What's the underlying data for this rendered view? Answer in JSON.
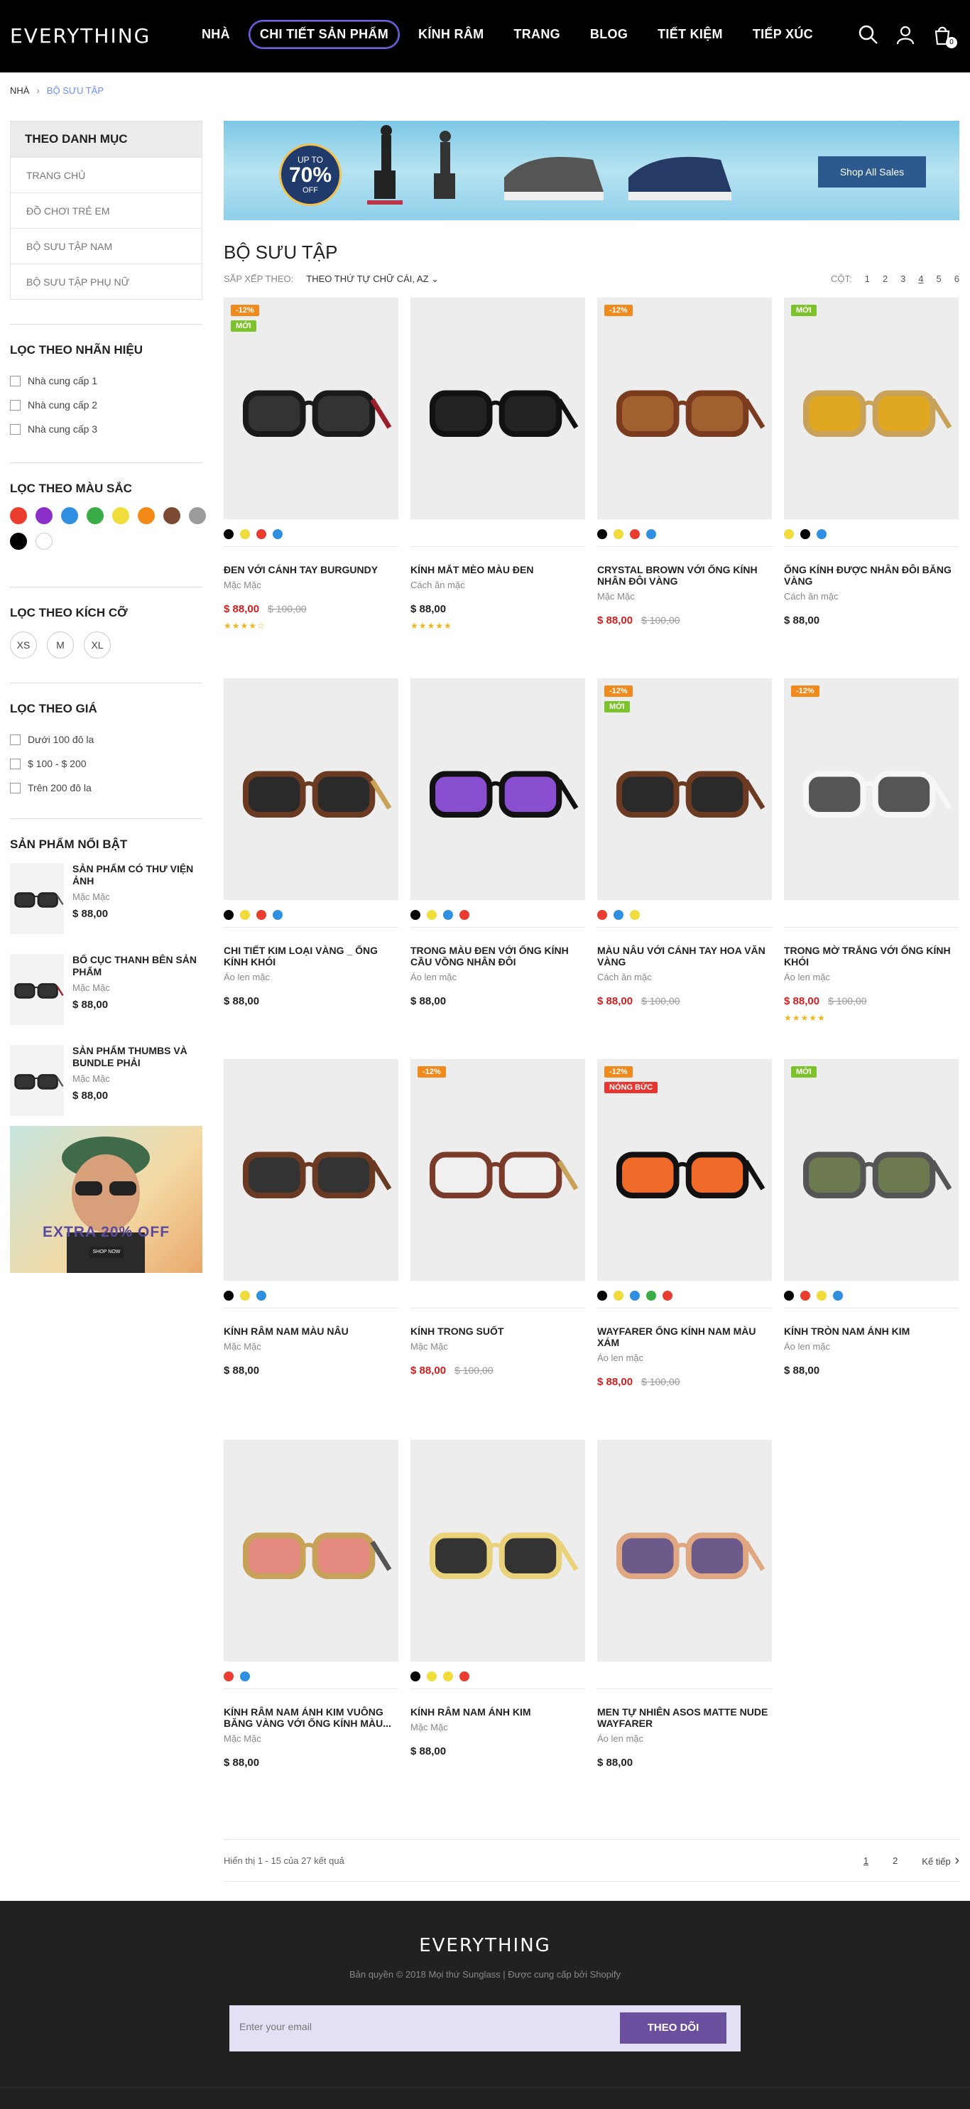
{
  "header": {
    "logo": "EVERYTHING",
    "nav": [
      "NHÀ",
      "CHI TIẾT SẢN PHẨM",
      "KÍNH RÂM",
      "TRANG",
      "BLOG",
      "TIẾT KIỆM",
      "TIẾP XÚC"
    ],
    "active_nav": "CHI TIẾT SẢN PHẨM",
    "cart_count": "0",
    "icons": [
      "search-icon",
      "user-icon",
      "cart-icon"
    ]
  },
  "breadcrumb": {
    "home": "NHÀ",
    "current": "BỘ SƯU TẬP"
  },
  "sidebar": {
    "category_title": "THEO DANH MỤC",
    "categories": [
      "TRANG CHỦ",
      "ĐỒ CHƠI TRẺ EM",
      "BỘ SƯU TẬP NAM",
      "BỘ SƯU TẬP PHỤ NỮ"
    ],
    "brand_title": "LỌC THEO NHÃN HIỆU",
    "brands": [
      "Nhà cung cấp 1",
      "Nhà cung cấp 2",
      "Nhà cung cấp 3"
    ],
    "color_title": "LỌC THEO MÀU SẮC",
    "colors": [
      "#ea3c2f",
      "#8c2fc9",
      "#2f8fe0",
      "#3aac46",
      "#f0dc3a",
      "#f38a17",
      "#7a4a32",
      "#9b9b9b",
      "#000000",
      "#ffffff"
    ],
    "size_title": "LỌC THEO KÍCH CỠ",
    "sizes": [
      "XS",
      "M",
      "XL"
    ],
    "price_title": "LỌC THEO GIÁ",
    "prices": [
      "Dưới 100 đô la",
      "$ 100 - $ 200",
      "Trên 200 đô la"
    ],
    "featured_title": "SẢN PHẨM NỔI BẬT",
    "featured": [
      {
        "name": "SẢN PHẨM CÓ THƯ VIỆN ẢNH",
        "vendor": "Mặc Mặc",
        "price": "$ 88,00"
      },
      {
        "name": "BỐ CỤC THANH BÊN SẢN PHẨM",
        "vendor": "Mặc Mặc",
        "price": "$ 88,00"
      },
      {
        "name": "SẢN PHẨM THUMBS VÀ BUNDLE PHẢI",
        "vendor": "Mặc Mặc",
        "price": "$ 88,00"
      }
    ],
    "banner_text": "EXTRA 20% OFF",
    "banner_button": "SHOP NOW"
  },
  "hero": {
    "up_to": "UP TO",
    "percent": "70%",
    "off": "OFF",
    "button": "Shop All Sales"
  },
  "collection": {
    "title": "BỘ SƯU TẬP",
    "sort_label": "SẮP XẾP THEO:",
    "sort_value": "THEO THỨ TỰ CHỮ CÁI, AZ",
    "cols_label": "CỘT:",
    "cols": [
      "1",
      "2",
      "3",
      "4",
      "5",
      "6"
    ],
    "active_col": "4"
  },
  "products": [
    {
      "name": "ĐEN VỚI CÁNH TAY BURGUNDY",
      "vendor": "Mặc Mặc",
      "price": "$ 88,00",
      "old_price": "$ 100,00",
      "badges": [
        "-12%",
        "MỚI"
      ],
      "colors": [
        "#000000",
        "#f0dc3a",
        "#ea3c2f",
        "#2f8fe0"
      ],
      "stars": "★★★★☆",
      "frame": "#1a1a1a",
      "arm": "#9b1f2a",
      "lens": "#333"
    },
    {
      "name": "KÍNH MẮT MÈO MÀU ĐEN",
      "vendor": "Cách ăn mặc",
      "price": "$ 88,00",
      "old_price": "",
      "badges": [],
      "colors": [],
      "stars": "★★★★★",
      "frame": "#111",
      "arm": "#111",
      "lens": "#222"
    },
    {
      "name": "CRYSTAL BROWN VỚI ỐNG KÍNH NHÂN ĐÔI VÀNG",
      "vendor": "Mặc Mặc",
      "price": "$ 88,00",
      "old_price": "$ 100,00",
      "badges": [
        "-12%"
      ],
      "colors": [
        "#000000",
        "#f0dc3a",
        "#ea3c2f",
        "#2f8fe0"
      ],
      "stars": "",
      "frame": "#7a3b1e",
      "arm": "#7a3b1e",
      "lens": "#a0602f"
    },
    {
      "name": "ỐNG KÍNH ĐƯỢC NHÂN ĐÔI BĂNG VÀNG",
      "vendor": "Cách ăn mặc",
      "price": "$ 88,00",
      "old_price": "",
      "badges": [
        "MỚI"
      ],
      "colors": [
        "#f0dc3a",
        "#000000",
        "#2f8fe0"
      ],
      "stars": "",
      "frame": "#c9a25a",
      "arm": "#c9a25a",
      "lens": "#e0a820"
    },
    {
      "name": "CHI TIẾT KIM LOẠI VÀNG _ ỐNG KÍNH KHÓI",
      "vendor": "Áo len mặc",
      "price": "$ 88,00",
      "old_price": "",
      "badges": [],
      "colors": [
        "#000000",
        "#f0dc3a",
        "#ea3c2f",
        "#2f8fe0"
      ],
      "stars": "",
      "frame": "#6b3a22",
      "arm": "#c9a25a",
      "lens": "#2a2a2a"
    },
    {
      "name": "TRONG MÀU ĐEN VỚI ỐNG KÍNH CẦU VỒNG NHÂN ĐÔI",
      "vendor": "Áo len mặc",
      "price": "$ 88,00",
      "old_price": "",
      "badges": [],
      "colors": [
        "#000000",
        "#f0dc3a",
        "#2f8fe0",
        "#ea3c2f"
      ],
      "stars": "",
      "frame": "#111",
      "arm": "#111",
      "lens": "#8a4fd0"
    },
    {
      "name": "MÀU NÂU VỚI CÁNH TAY HOA VĂN VÀNG",
      "vendor": "Cách ăn mặc",
      "price": "$ 88,00",
      "old_price": "$ 100,00",
      "badges": [
        "-12%",
        "MỚI"
      ],
      "colors": [
        "#ea3c2f",
        "#2f8fe0",
        "#f0dc3a"
      ],
      "stars": "",
      "frame": "#6b3a22",
      "arm": "#6b3a22",
      "lens": "#2a2a2a"
    },
    {
      "name": "TRONG MỜ TRẮNG VỚI ỐNG KÍNH KHÓI",
      "vendor": "Áo len mặc",
      "price": "$ 88,00",
      "old_price": "$ 100,00",
      "badges": [
        "-12%"
      ],
      "colors": [],
      "stars": "★★★★★",
      "frame": "#f6f6f6",
      "arm": "#f6f6f6",
      "lens": "#555"
    },
    {
      "name": "KÍNH RÂM NAM MÀU NÂU",
      "vendor": "Mặc Mặc",
      "price": "$ 88,00",
      "old_price": "",
      "badges": [],
      "colors": [
        "#000000",
        "#f0dc3a",
        "#2f8fe0"
      ],
      "stars": "",
      "frame": "#6b3a22",
      "arm": "#6b3a22",
      "lens": "#333"
    },
    {
      "name": "KÍNH TRONG SUỐT",
      "vendor": "Mặc Mặc",
      "price": "$ 88,00",
      "old_price": "$ 100,00",
      "badges": [
        "-12%"
      ],
      "colors": [],
      "stars": "",
      "frame": "#7a3b2a",
      "arm": "#c9a25a",
      "lens": "#f0f0f0"
    },
    {
      "name": "WAYFARER ỐNG KÍNH NAM MÀU XÁM",
      "vendor": "Áo len mặc",
      "price": "$ 88,00",
      "old_price": "$ 100,00",
      "badges": [
        "-12%",
        "NÓNG BỨC"
      ],
      "colors": [
        "#000000",
        "#f0dc3a",
        "#2f8fe0",
        "#3aac46",
        "#ea3c2f"
      ],
      "stars": "",
      "frame": "#111",
      "arm": "#111",
      "lens": "#f06a2a"
    },
    {
      "name": "KÍNH TRÒN NAM ÁNH KIM",
      "vendor": "Áo len mặc",
      "price": "$ 88,00",
      "old_price": "",
      "badges": [
        "MỚI"
      ],
      "colors": [
        "#000000",
        "#ea3c2f",
        "#f0dc3a",
        "#2f8fe0"
      ],
      "stars": "",
      "frame": "#555",
      "arm": "#555",
      "lens": "#6d7a50"
    },
    {
      "name": "KÍNH RÂM NAM ÁNH KIM VUÔNG BĂNG VÀNG VỚI ỐNG KÍNH MÀU...",
      "vendor": "Mặc Mặc",
      "price": "$ 88,00",
      "old_price": "",
      "badges": [],
      "colors": [
        "#ea3c2f",
        "#2f8fe0"
      ],
      "stars": "",
      "frame": "#c9a25a",
      "arm": "#555",
      "lens": "#e58a80"
    },
    {
      "name": "KÍNH RÂM NAM ÁNH KIM",
      "vendor": "Mặc Mặc",
      "price": "$ 88,00",
      "old_price": "",
      "badges": [],
      "colors": [
        "#000000",
        "#f0dc3a",
        "#f0dc3a",
        "#ea3c2f"
      ],
      "stars": "",
      "frame": "#e9d27a",
      "arm": "#e9d27a",
      "lens": "#333"
    },
    {
      "name": "MEN TỰ NHIÊN ASOS MATTE NUDE WAYFARER",
      "vendor": "Áo len mặc",
      "price": "$ 88,00",
      "old_price": "",
      "badges": [],
      "colors": [],
      "stars": "",
      "frame": "#e0a882",
      "arm": "#e0a882",
      "lens": "#6b5a8a"
    }
  ],
  "pagination": {
    "summary": "Hiển thị 1 - 15 của 27 kết quả",
    "pages": [
      "1",
      "2"
    ],
    "active": "1",
    "next": "Kế tiếp"
  },
  "footer": {
    "logo": "EVERYTHING",
    "copyright": "Bản quyền © 2018 Mọi thứ Sunglass | Được cung cấp bởi Shopify",
    "email_placeholder": "Enter your email",
    "subscribe": "THEO DÕI"
  }
}
